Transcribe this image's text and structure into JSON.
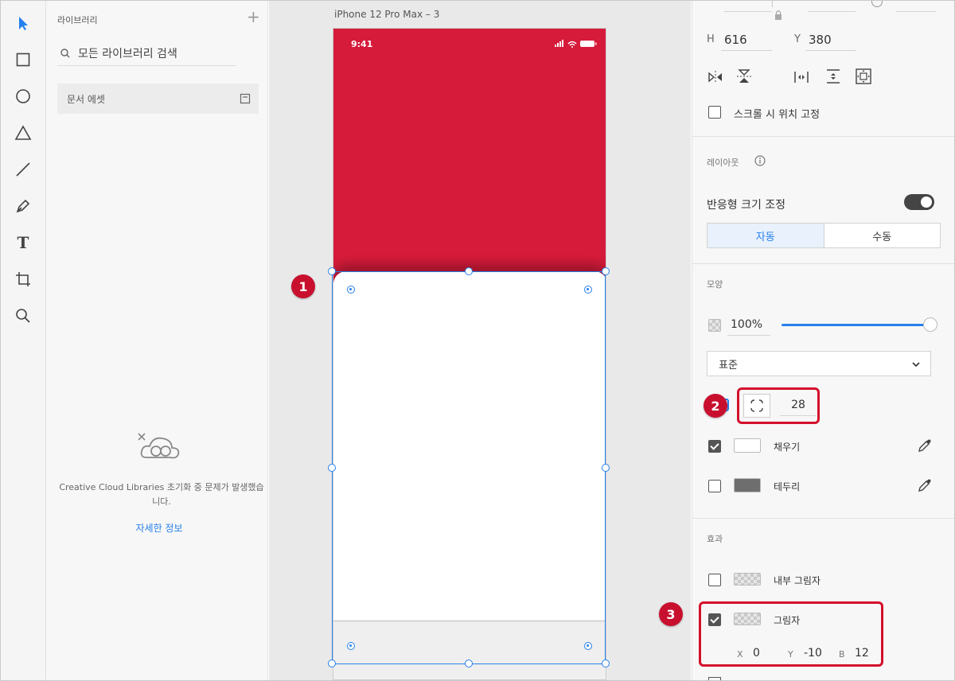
{
  "toolbar": {
    "tools": [
      "select-icon",
      "rectangle-icon",
      "ellipse-icon",
      "triangle-icon",
      "line-icon",
      "pen-icon",
      "text-icon",
      "artboard-icon",
      "zoom-icon"
    ],
    "text_tool_glyph": "T"
  },
  "library": {
    "title": "라이브러리",
    "add_glyph": "+",
    "search_placeholder": "모든 라이브러리 검색",
    "doc_assets": "문서 에셋",
    "message": "Creative Cloud Libraries 초기화 중 문제가 발생했습니다.",
    "link": "자세한 정보"
  },
  "canvas": {
    "artboard_title": "iPhone 12 Pro Max – 3",
    "status_time": "9:41",
    "hero_color": "#d61b3a",
    "selection_color": "#2680eb"
  },
  "badges": {
    "one": "1",
    "two": "2",
    "three": "3"
  },
  "props": {
    "h_label": "H",
    "h_value": "616",
    "y_label": "Y",
    "y_value": "380",
    "fixed_scroll": "스크롤 시 위치 고정",
    "layout_title": "레이아웃",
    "responsive_resize": "반응형 크기 조정",
    "seg_auto": "자동",
    "seg_manual": "수동",
    "appearance_title": "모양",
    "opacity": "100%",
    "blend_mode": "표준",
    "corner_radius": "28",
    "fill_label": "채우기",
    "border_label": "테두리",
    "effects_title": "효과",
    "inner_shadow": "내부 그림자",
    "shadow": "그림자",
    "shadow_x_label": "X",
    "shadow_x": "0",
    "shadow_y_label": "Y",
    "shadow_y": "-10",
    "shadow_b_label": "B",
    "shadow_b": "12",
    "fill_checked": true,
    "border_checked": false,
    "inner_shadow_checked": false,
    "shadow_checked": true,
    "fixed_scroll_checked": false,
    "fill_color": "#ffffff",
    "border_color": "#6e6e6e",
    "highlight_color": "#d3102c"
  }
}
